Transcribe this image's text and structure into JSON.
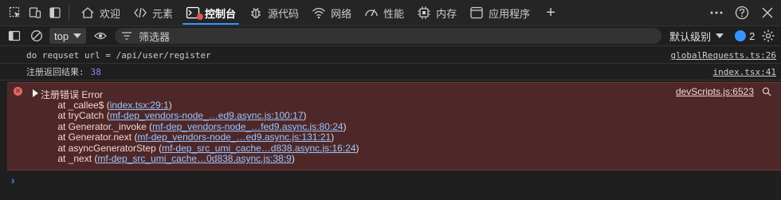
{
  "tabbar": {
    "tabs": [
      {
        "label": "欢迎",
        "icon": "home-icon"
      },
      {
        "label": "元素",
        "icon": "code-icon"
      },
      {
        "label": "控制台",
        "icon": "console-icon",
        "active": true
      },
      {
        "label": "源代码",
        "icon": "bug-icon"
      },
      {
        "label": "网络",
        "icon": "wifi-icon"
      },
      {
        "label": "性能",
        "icon": "gauge-icon"
      },
      {
        "label": "内存",
        "icon": "chip-icon"
      },
      {
        "label": "应用程序",
        "icon": "app-icon"
      }
    ],
    "add_label": "+"
  },
  "toolbar": {
    "context": "top",
    "filter_placeholder": "筛选器",
    "level_label": "默认级别",
    "issues_count": "2"
  },
  "console": {
    "rows": [
      {
        "text": "do requset url = /api/user/register",
        "source": "globalRequests.ts:26"
      },
      {
        "text": "注册返回结果:",
        "number": "38",
        "source": "index.tsx:41"
      }
    ],
    "error": {
      "head": "注册错误 Error",
      "source": "devScripts.js:6523",
      "stack": [
        {
          "prefix": "    at _callee$ (",
          "link": "index.tsx:29:1",
          "suffix": ")"
        },
        {
          "prefix": "    at tryCatch (",
          "link": "mf-dep_vendors-node_…ed9.async.js:100:17",
          "suffix": ")"
        },
        {
          "prefix": "    at Generator._invoke (",
          "link": "mf-dep_vendors-node_…fed9.async.js:80:24",
          "suffix": ")"
        },
        {
          "prefix": "    at Generator.next (",
          "link": "mf-dep_vendors-node_…ed9.async.js:131:21",
          "suffix": ")"
        },
        {
          "prefix": "    at asyncGeneratorStep (",
          "link": "mf-dep_src_umi_cache…d838.async.js:16:24",
          "suffix": ")"
        },
        {
          "prefix": "    at _next (",
          "link": "mf-dep_src_umi_cache…0d838.async.js:38:9",
          "suffix": ")"
        }
      ]
    },
    "prompt": "›"
  },
  "colors": {
    "accent": "#3794ff",
    "error_bg": "#4e2828",
    "error_icon": "#e46962",
    "number": "#9980ff"
  }
}
